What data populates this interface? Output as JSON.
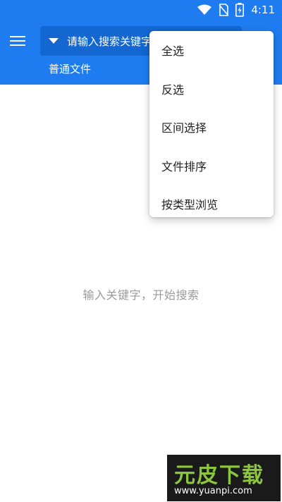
{
  "status": {
    "time": "4:11"
  },
  "header": {
    "search_placeholder": "请输入搜索关键字",
    "file_type": "普通文件"
  },
  "main": {
    "empty_message": "输入关键字，开始搜索"
  },
  "dropdown": {
    "items": [
      {
        "label": "全选"
      },
      {
        "label": "反选"
      },
      {
        "label": "区间选择"
      },
      {
        "label": "文件排序"
      },
      {
        "label": "按类型浏览"
      }
    ]
  },
  "watermark": {
    "title": "元皮下载",
    "url": "www.yuanpi.com"
  },
  "colors": {
    "primary": "#1e7cf0",
    "search_bg": "#1466d1"
  }
}
